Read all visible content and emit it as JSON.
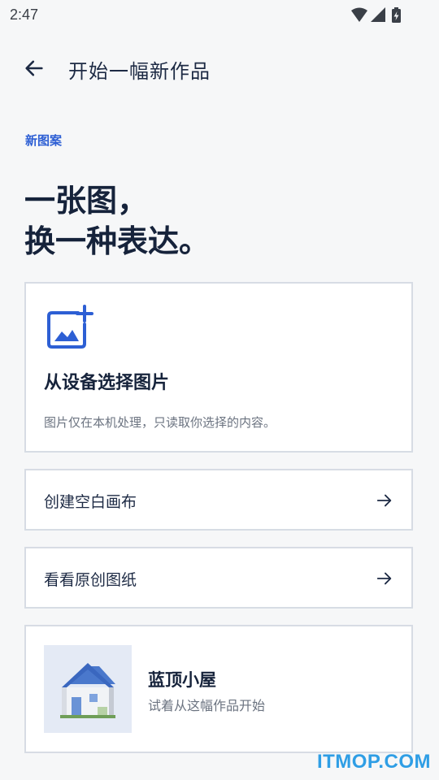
{
  "status_bar": {
    "time": "2:47"
  },
  "app_bar": {
    "title": "开始一幅新作品",
    "back_icon": "arrow-left-icon"
  },
  "hero": {
    "eyebrow": "新图案",
    "headline_line1": "一张图，",
    "headline_line2": "换一种表达。"
  },
  "pick_card": {
    "icon": "add-photo-icon",
    "title": "从设备选择图片",
    "description": "图片仅在本机处理，只读取你选择的内容。"
  },
  "actions": [
    {
      "label": "创建空白画布",
      "icon": "arrow-right-icon"
    },
    {
      "label": "看看原创图纸",
      "icon": "arrow-right-icon"
    }
  ],
  "sample_card": {
    "thumbnail_icon": "pixel-house-icon",
    "title": "蓝顶小屋",
    "description": "试着从这幅作品开始"
  },
  "watermark": "ITMOP.COM",
  "colors": {
    "accent": "#2d5fd4",
    "text_primary": "#16233b",
    "text_secondary": "#6b7380",
    "background": "#f6f7f8",
    "card_border": "#d7dce4"
  }
}
